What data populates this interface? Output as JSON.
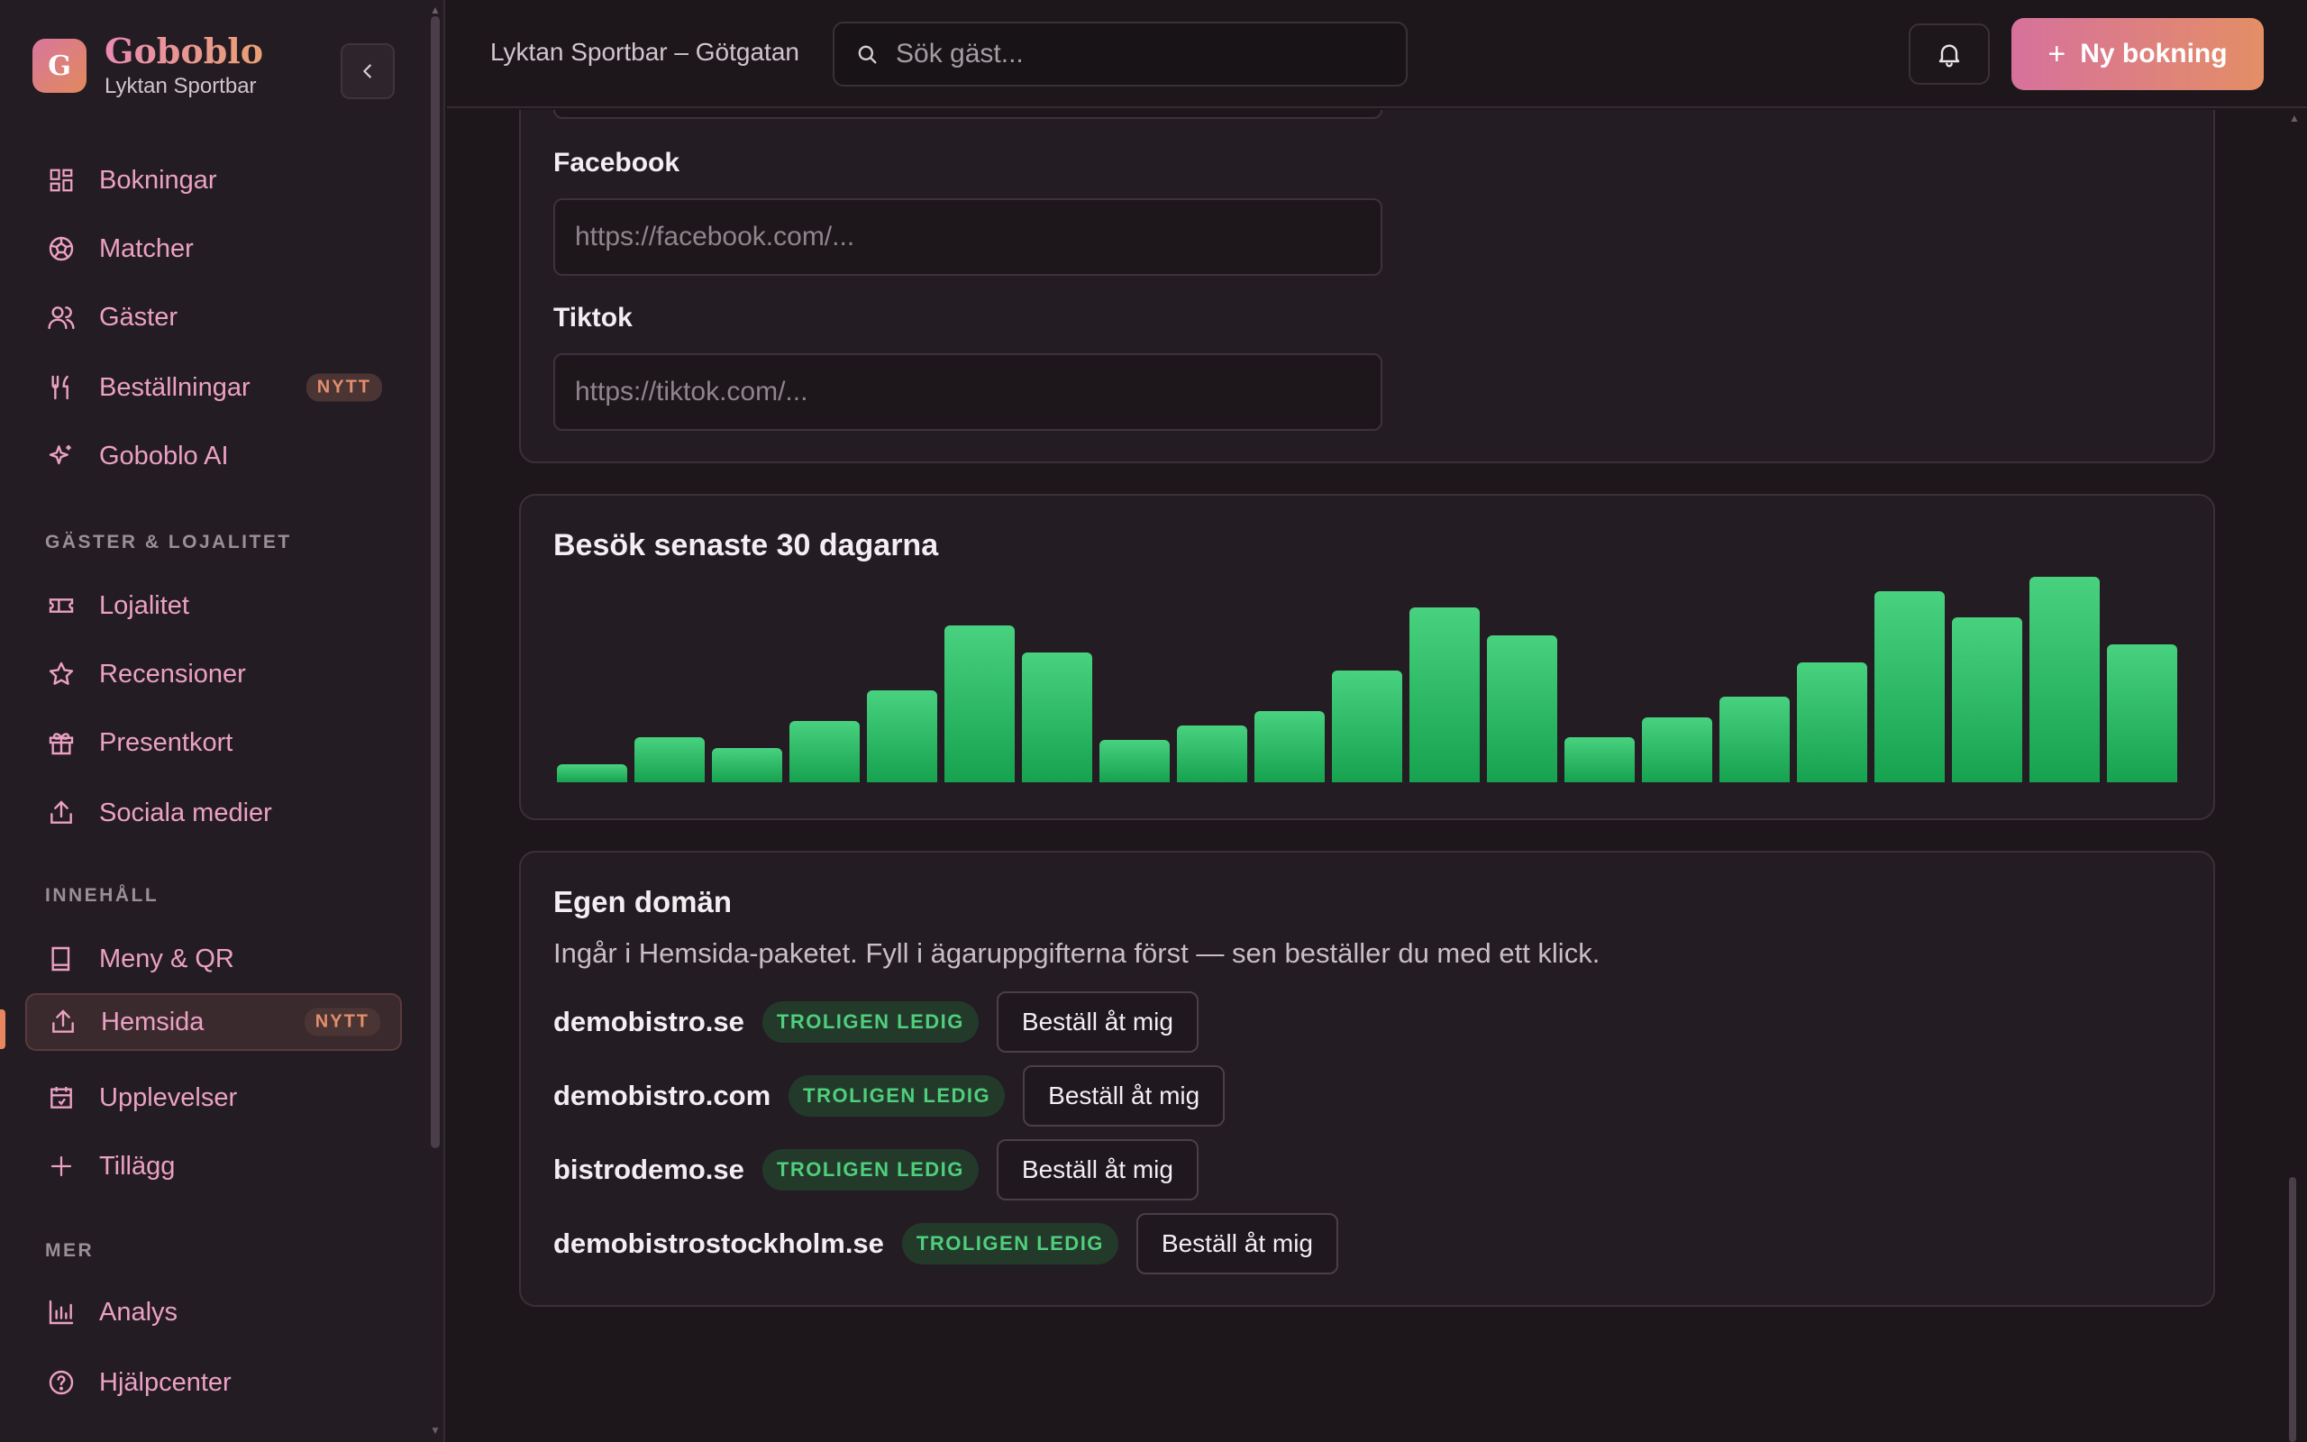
{
  "brand": {
    "logo_letter": "G",
    "name": "Goboblo",
    "subtitle": "Lyktan Sportbar"
  },
  "sidebar": {
    "main_items": [
      {
        "label": "Bokningar",
        "icon": "grid-icon"
      },
      {
        "label": "Matcher",
        "icon": "football-icon"
      },
      {
        "label": "Gäster",
        "icon": "users-icon"
      },
      {
        "label": "Beställningar",
        "icon": "utensils-icon",
        "badge": "NYTT"
      },
      {
        "label": "Goboblo AI",
        "icon": "sparkle-icon"
      }
    ],
    "section_guests": "GÄSTER & LOJALITET",
    "guest_items": [
      {
        "label": "Lojalitet",
        "icon": "ticket-icon"
      },
      {
        "label": "Recensioner",
        "icon": "star-icon"
      },
      {
        "label": "Presentkort",
        "icon": "gift-icon"
      },
      {
        "label": "Sociala medier",
        "icon": "share-icon"
      }
    ],
    "section_content": "INNEHÅLL",
    "content_items": [
      {
        "label": "Meny & QR",
        "icon": "book-icon"
      },
      {
        "label": "Hemsida",
        "icon": "share-icon",
        "badge": "NYTT",
        "active": true
      },
      {
        "label": "Upplevelser",
        "icon": "calendar-icon"
      },
      {
        "label": "Tillägg",
        "icon": "plus-icon"
      }
    ],
    "section_more": "MER",
    "more_items": [
      {
        "label": "Analys",
        "icon": "bar-chart-icon"
      },
      {
        "label": "Hjälpcenter",
        "icon": "help-icon"
      }
    ]
  },
  "topbar": {
    "location": "Lyktan Sportbar – Götgatan",
    "search_placeholder": "Sök gäst...",
    "new_booking_label": "Ny bokning"
  },
  "social": {
    "facebook_label": "Facebook",
    "facebook_placeholder": "https://facebook.com/...",
    "tiktok_label": "Tiktok",
    "tiktok_placeholder": "https://tiktok.com/..."
  },
  "visits": {
    "title": "Besök senaste 30 dagarna"
  },
  "chart_data": {
    "type": "bar",
    "title": "Besök senaste 30 dagarna",
    "xlabel": "",
    "ylabel": "",
    "grid": false,
    "values": [
      9,
      22,
      17,
      30,
      45,
      77,
      64,
      21,
      28,
      35,
      55,
      86,
      72,
      22,
      32,
      42,
      59,
      94,
      81,
      101,
      68
    ],
    "ylim": [
      0,
      101
    ],
    "colors": {
      "bar_top": "#48d27f",
      "bar_bottom": "#17a250"
    }
  },
  "domain": {
    "title": "Egen domän",
    "description": "Ingår i Hemsida-paketet. Fyll i ägaruppgifterna först — sen beställer du med ett klick.",
    "rows": [
      {
        "name": "demobistro.se",
        "status": "TROLIGEN LEDIG",
        "action": "Beställ åt mig"
      },
      {
        "name": "demobistro.com",
        "status": "TROLIGEN LEDIG",
        "action": "Beställ åt mig"
      },
      {
        "name": "bistrodemo.se",
        "status": "TROLIGEN LEDIG",
        "action": "Beställ åt mig"
      },
      {
        "name": "demobistrostockholm.se",
        "status": "TROLIGEN LEDIG",
        "action": "Beställ åt mig"
      }
    ]
  },
  "colors": {
    "accent_pink": "#eba1c3",
    "accent_orange": "#e48e66",
    "status_green": "#4fcf7c"
  }
}
